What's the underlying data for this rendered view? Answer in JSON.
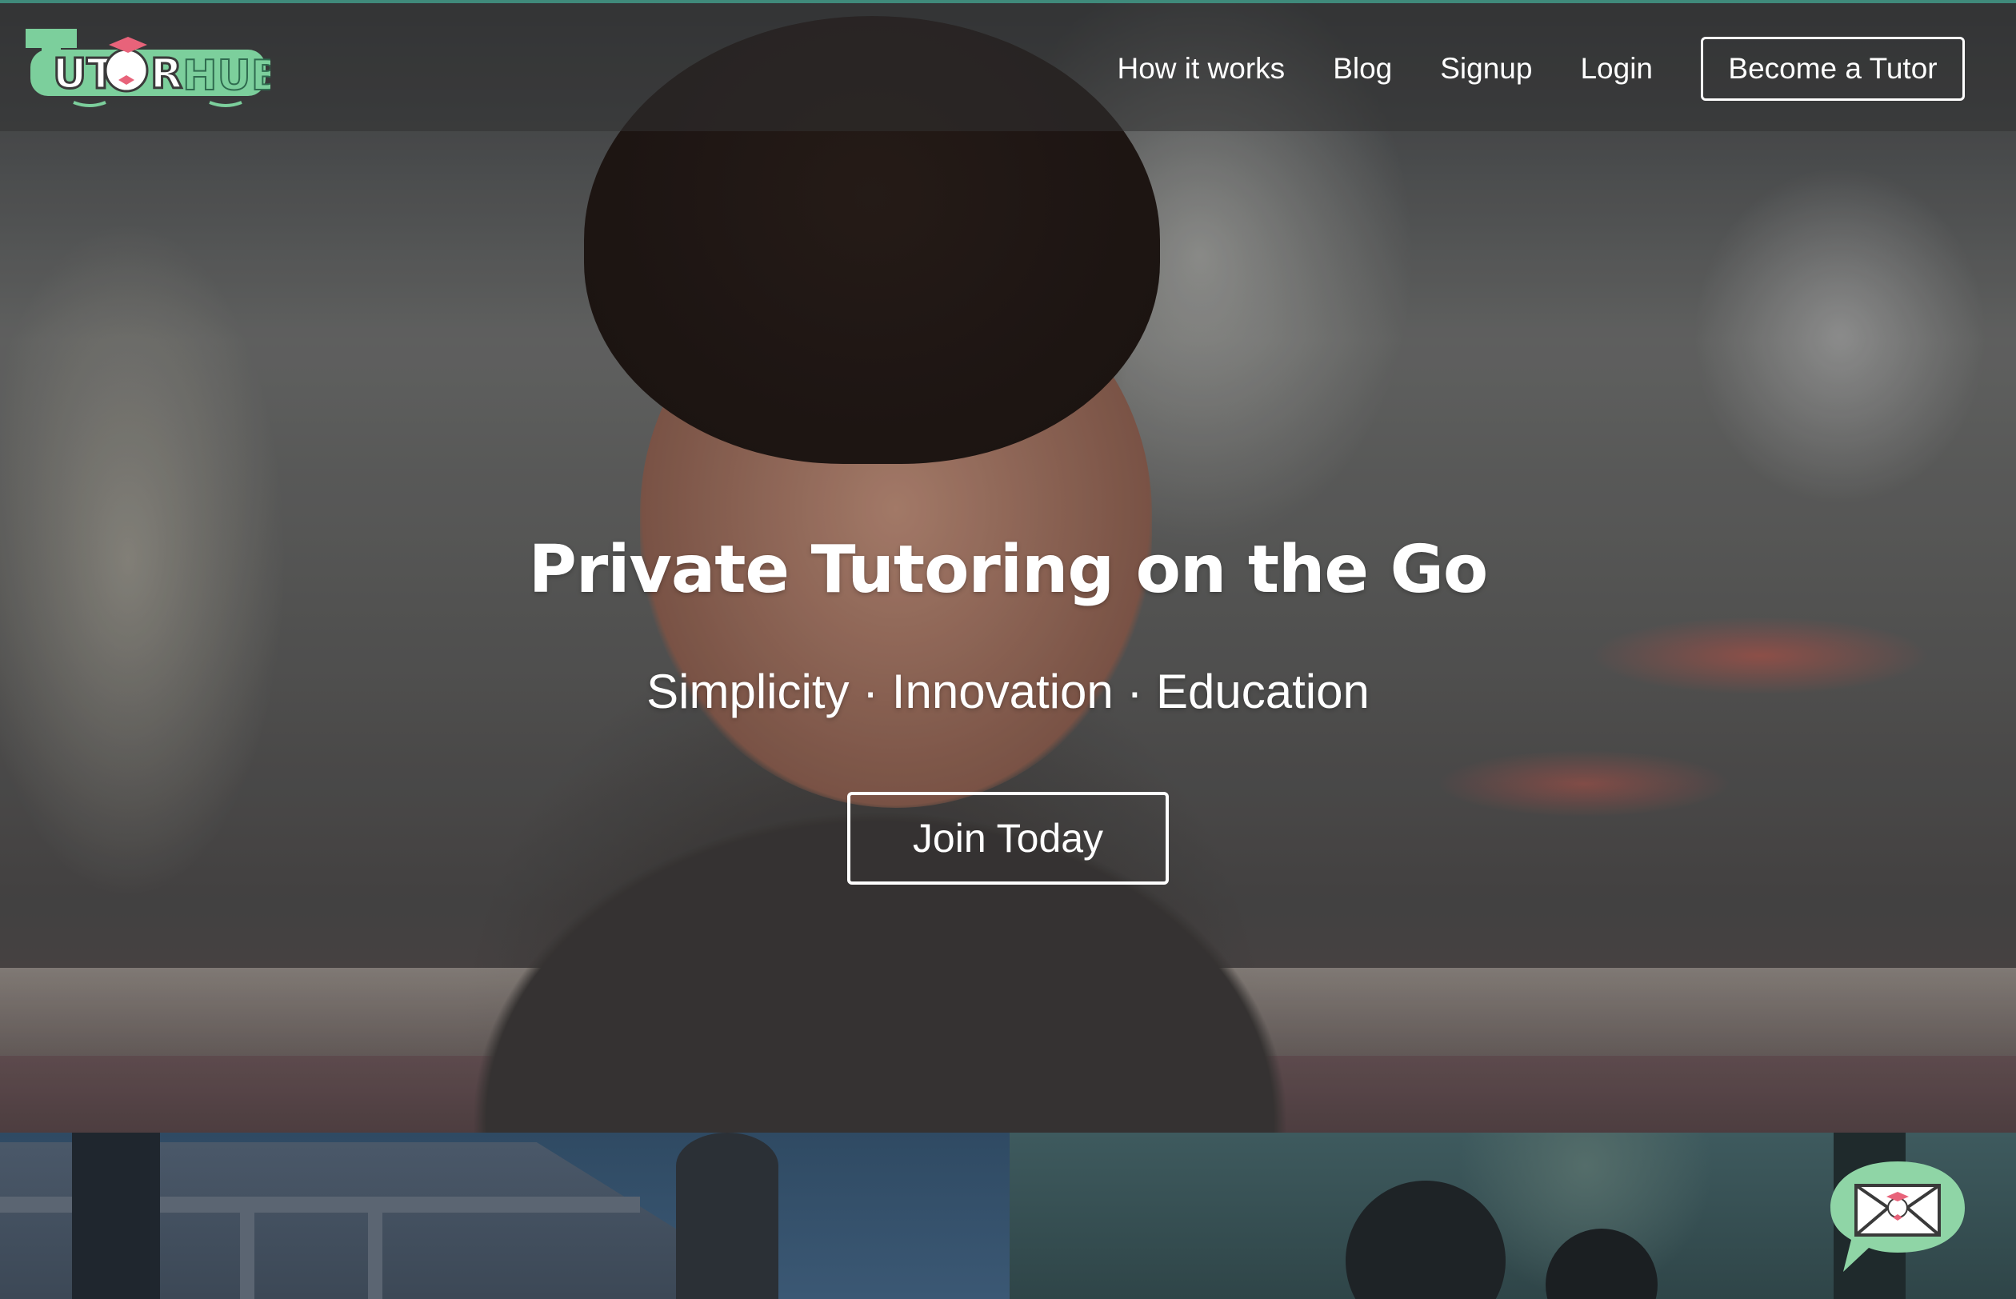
{
  "brand": {
    "name": "TutorHub",
    "logo_text": "TUTORHUB",
    "logo_color": "#7ccf9c",
    "accent_color": "#e8637a"
  },
  "nav": {
    "links": [
      {
        "label": "How it works"
      },
      {
        "label": "Blog"
      },
      {
        "label": "Signup"
      },
      {
        "label": "Login"
      }
    ],
    "cta_label": "Become a Tutor"
  },
  "hero": {
    "headline": "Private Tutoring on the Go",
    "tagline": "Simplicity · Innovation · Education",
    "cta_label": "Join Today"
  },
  "chat_widget": {
    "icon": "envelope-icon",
    "bubble_color": "#8fd5a6"
  }
}
